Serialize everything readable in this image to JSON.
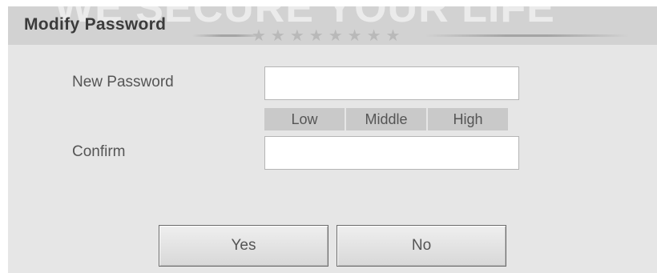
{
  "dialog": {
    "title": "Modify Password",
    "watermark": "WE SECURE YOUR LIFE",
    "stars": "★★★★★★★★"
  },
  "form": {
    "new_password_label": "New Password",
    "new_password_value": "",
    "confirm_label": "Confirm",
    "confirm_value": "",
    "strength_levels": [
      "Low",
      "Middle",
      "High"
    ]
  },
  "buttons": {
    "yes_label": "Yes",
    "no_label": "No"
  }
}
